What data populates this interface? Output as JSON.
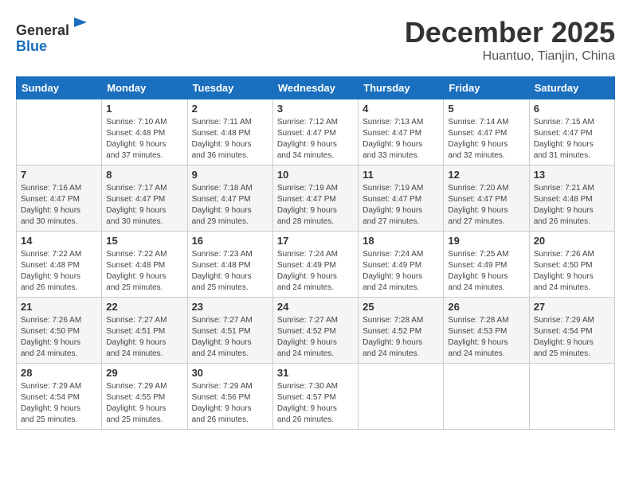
{
  "header": {
    "logo_line1": "General",
    "logo_line2": "Blue",
    "month": "December 2025",
    "location": "Huantuo, Tianjin, China"
  },
  "weekdays": [
    "Sunday",
    "Monday",
    "Tuesday",
    "Wednesday",
    "Thursday",
    "Friday",
    "Saturday"
  ],
  "weeks": [
    [
      {
        "day": "",
        "info": ""
      },
      {
        "day": "1",
        "info": "Sunrise: 7:10 AM\nSunset: 4:48 PM\nDaylight: 9 hours\nand 37 minutes."
      },
      {
        "day": "2",
        "info": "Sunrise: 7:11 AM\nSunset: 4:48 PM\nDaylight: 9 hours\nand 36 minutes."
      },
      {
        "day": "3",
        "info": "Sunrise: 7:12 AM\nSunset: 4:47 PM\nDaylight: 9 hours\nand 34 minutes."
      },
      {
        "day": "4",
        "info": "Sunrise: 7:13 AM\nSunset: 4:47 PM\nDaylight: 9 hours\nand 33 minutes."
      },
      {
        "day": "5",
        "info": "Sunrise: 7:14 AM\nSunset: 4:47 PM\nDaylight: 9 hours\nand 32 minutes."
      },
      {
        "day": "6",
        "info": "Sunrise: 7:15 AM\nSunset: 4:47 PM\nDaylight: 9 hours\nand 31 minutes."
      }
    ],
    [
      {
        "day": "7",
        "info": "Sunrise: 7:16 AM\nSunset: 4:47 PM\nDaylight: 9 hours\nand 30 minutes."
      },
      {
        "day": "8",
        "info": "Sunrise: 7:17 AM\nSunset: 4:47 PM\nDaylight: 9 hours\nand 30 minutes."
      },
      {
        "day": "9",
        "info": "Sunrise: 7:18 AM\nSunset: 4:47 PM\nDaylight: 9 hours\nand 29 minutes."
      },
      {
        "day": "10",
        "info": "Sunrise: 7:19 AM\nSunset: 4:47 PM\nDaylight: 9 hours\nand 28 minutes."
      },
      {
        "day": "11",
        "info": "Sunrise: 7:19 AM\nSunset: 4:47 PM\nDaylight: 9 hours\nand 27 minutes."
      },
      {
        "day": "12",
        "info": "Sunrise: 7:20 AM\nSunset: 4:47 PM\nDaylight: 9 hours\nand 27 minutes."
      },
      {
        "day": "13",
        "info": "Sunrise: 7:21 AM\nSunset: 4:48 PM\nDaylight: 9 hours\nand 26 minutes."
      }
    ],
    [
      {
        "day": "14",
        "info": "Sunrise: 7:22 AM\nSunset: 4:48 PM\nDaylight: 9 hours\nand 26 minutes."
      },
      {
        "day": "15",
        "info": "Sunrise: 7:22 AM\nSunset: 4:48 PM\nDaylight: 9 hours\nand 25 minutes."
      },
      {
        "day": "16",
        "info": "Sunrise: 7:23 AM\nSunset: 4:48 PM\nDaylight: 9 hours\nand 25 minutes."
      },
      {
        "day": "17",
        "info": "Sunrise: 7:24 AM\nSunset: 4:49 PM\nDaylight: 9 hours\nand 24 minutes."
      },
      {
        "day": "18",
        "info": "Sunrise: 7:24 AM\nSunset: 4:49 PM\nDaylight: 9 hours\nand 24 minutes."
      },
      {
        "day": "19",
        "info": "Sunrise: 7:25 AM\nSunset: 4:49 PM\nDaylight: 9 hours\nand 24 minutes."
      },
      {
        "day": "20",
        "info": "Sunrise: 7:26 AM\nSunset: 4:50 PM\nDaylight: 9 hours\nand 24 minutes."
      }
    ],
    [
      {
        "day": "21",
        "info": "Sunrise: 7:26 AM\nSunset: 4:50 PM\nDaylight: 9 hours\nand 24 minutes."
      },
      {
        "day": "22",
        "info": "Sunrise: 7:27 AM\nSunset: 4:51 PM\nDaylight: 9 hours\nand 24 minutes."
      },
      {
        "day": "23",
        "info": "Sunrise: 7:27 AM\nSunset: 4:51 PM\nDaylight: 9 hours\nand 24 minutes."
      },
      {
        "day": "24",
        "info": "Sunrise: 7:27 AM\nSunset: 4:52 PM\nDaylight: 9 hours\nand 24 minutes."
      },
      {
        "day": "25",
        "info": "Sunrise: 7:28 AM\nSunset: 4:52 PM\nDaylight: 9 hours\nand 24 minutes."
      },
      {
        "day": "26",
        "info": "Sunrise: 7:28 AM\nSunset: 4:53 PM\nDaylight: 9 hours\nand 24 minutes."
      },
      {
        "day": "27",
        "info": "Sunrise: 7:29 AM\nSunset: 4:54 PM\nDaylight: 9 hours\nand 25 minutes."
      }
    ],
    [
      {
        "day": "28",
        "info": "Sunrise: 7:29 AM\nSunset: 4:54 PM\nDaylight: 9 hours\nand 25 minutes."
      },
      {
        "day": "29",
        "info": "Sunrise: 7:29 AM\nSunset: 4:55 PM\nDaylight: 9 hours\nand 25 minutes."
      },
      {
        "day": "30",
        "info": "Sunrise: 7:29 AM\nSunset: 4:56 PM\nDaylight: 9 hours\nand 26 minutes."
      },
      {
        "day": "31",
        "info": "Sunrise: 7:30 AM\nSunset: 4:57 PM\nDaylight: 9 hours\nand 26 minutes."
      },
      {
        "day": "",
        "info": ""
      },
      {
        "day": "",
        "info": ""
      },
      {
        "day": "",
        "info": ""
      }
    ]
  ]
}
